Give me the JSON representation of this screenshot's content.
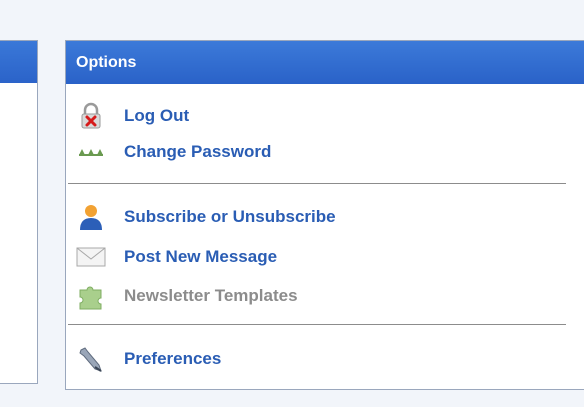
{
  "options": {
    "title": "Options",
    "items": [
      {
        "label": "Log Out",
        "icon": "lock-logout-icon",
        "enabled": true
      },
      {
        "label": "Change Password",
        "icon": "password-dots-icon",
        "enabled": true
      },
      {
        "label": "Subscribe or Unsubscribe",
        "icon": "user-icon",
        "enabled": true
      },
      {
        "label": "Post New Message",
        "icon": "envelope-icon",
        "enabled": true
      },
      {
        "label": "Newsletter Templates",
        "icon": "puzzle-icon",
        "enabled": false
      },
      {
        "label": "Preferences",
        "icon": "wrench-icon",
        "enabled": true
      }
    ]
  },
  "colors": {
    "header": "#2b63c9",
    "link": "#2a5db4",
    "disabled": "#8c8c8c"
  }
}
